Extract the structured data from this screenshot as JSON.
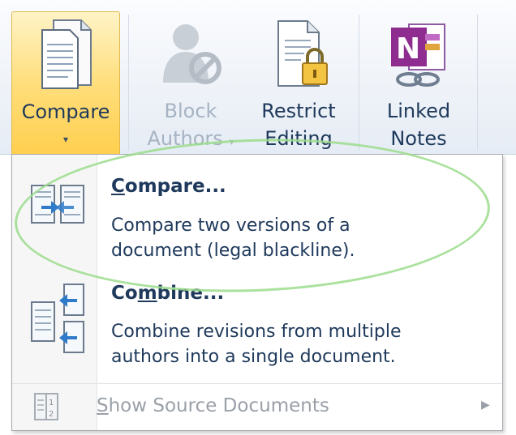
{
  "ribbon": {
    "compare": {
      "label": "Compare",
      "arrow": "▾",
      "icon": "compare-document-icon"
    },
    "block_authors": {
      "line1": "Block",
      "line2": "Authors",
      "arrow": "▾",
      "icon": "block-authors-icon",
      "state": "disabled"
    },
    "restrict_editing": {
      "line1": "Restrict",
      "line2": "Editing",
      "icon": "lock-document-icon"
    },
    "linked_notes": {
      "line1": "Linked",
      "line2": "Notes",
      "icon": "onenote-linked-icon"
    }
  },
  "menu": {
    "items": [
      {
        "title_pre": "",
        "title_u": "C",
        "title_post": "ompare...",
        "desc1": "Compare two versions of a",
        "desc2": "document (legal blackline).",
        "icon": "compare-versions-icon"
      },
      {
        "title_pre": "Co",
        "title_u": "m",
        "title_post": "bine...",
        "desc1": "Combine revisions from multiple",
        "desc2": "authors into a single document.",
        "icon": "combine-documents-icon"
      }
    ],
    "source": {
      "u": "S",
      "rest": "how Source Documents",
      "state": "disabled",
      "icon": "source-documents-icon",
      "submenu_arrow": "▶"
    }
  },
  "colors": {
    "ribbon_text": "#1e395b",
    "hover_gold": "#ffde7c",
    "annotation_green": "#9bdc8c"
  }
}
